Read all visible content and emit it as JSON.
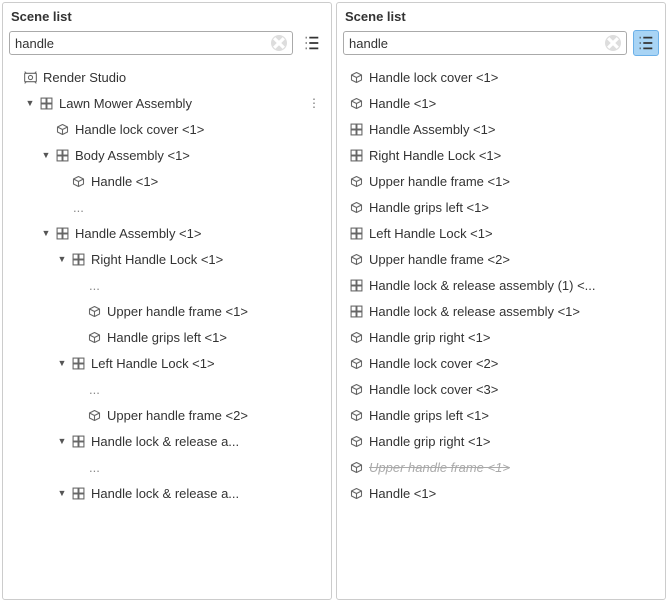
{
  "leftPanel": {
    "title": "Scene list",
    "searchValue": "handle",
    "listToggleActive": false,
    "rows": [
      {
        "depth": 0,
        "expander": "",
        "icon": "studio",
        "label": "Render Studio",
        "dots": false
      },
      {
        "depth": 1,
        "expander": "▼",
        "icon": "assembly",
        "label": "Lawn Mower Assembly",
        "dots": true
      },
      {
        "depth": 2,
        "expander": "",
        "icon": "part",
        "label": "Handle lock cover <1>"
      },
      {
        "depth": 2,
        "expander": "▼",
        "icon": "assembly",
        "label": "Body Assembly <1>"
      },
      {
        "depth": 3,
        "expander": "",
        "icon": "part",
        "label": "Handle <1>"
      },
      {
        "depth": 3,
        "expander": "",
        "icon": "none",
        "label": "...",
        "ellipsis": true
      },
      {
        "depth": 2,
        "expander": "▼",
        "icon": "assembly",
        "label": "Handle Assembly <1>"
      },
      {
        "depth": 3,
        "expander": "▼",
        "icon": "assembly",
        "label": "Right Handle Lock <1>"
      },
      {
        "depth": 4,
        "expander": "",
        "icon": "none",
        "label": "...",
        "ellipsis": true
      },
      {
        "depth": 4,
        "expander": "",
        "icon": "part",
        "label": "Upper handle frame <1>"
      },
      {
        "depth": 4,
        "expander": "",
        "icon": "part",
        "label": "Handle grips left <1>"
      },
      {
        "depth": 3,
        "expander": "▼",
        "icon": "assembly",
        "label": "Left Handle Lock <1>"
      },
      {
        "depth": 4,
        "expander": "",
        "icon": "none",
        "label": "...",
        "ellipsis": true
      },
      {
        "depth": 4,
        "expander": "",
        "icon": "part",
        "label": "Upper handle frame <2>"
      },
      {
        "depth": 3,
        "expander": "▼",
        "icon": "assembly",
        "label": "Handle lock & release a..."
      },
      {
        "depth": 4,
        "expander": "",
        "icon": "none",
        "label": "...",
        "ellipsis": true
      },
      {
        "depth": 3,
        "expander": "▼",
        "icon": "assembly",
        "label": "Handle lock & release a..."
      }
    ]
  },
  "rightPanel": {
    "title": "Scene list",
    "searchValue": "handle",
    "listToggleActive": true,
    "rows": [
      {
        "icon": "part",
        "label": "Handle lock cover <1>"
      },
      {
        "icon": "part",
        "label": "Handle <1>"
      },
      {
        "icon": "assembly",
        "label": "Handle Assembly <1>"
      },
      {
        "icon": "assembly",
        "label": "Right Handle Lock <1>"
      },
      {
        "icon": "part",
        "label": "Upper handle frame <1>"
      },
      {
        "icon": "part",
        "label": "Handle grips left <1>"
      },
      {
        "icon": "assembly",
        "label": "Left Handle Lock <1>"
      },
      {
        "icon": "part",
        "label": "Upper handle frame <2>"
      },
      {
        "icon": "assembly",
        "label": "Handle lock & release assembly (1) <..."
      },
      {
        "icon": "assembly",
        "label": "Handle lock & release assembly <1>"
      },
      {
        "icon": "part",
        "label": "Handle grip right <1>"
      },
      {
        "icon": "part",
        "label": "Handle lock cover <2>"
      },
      {
        "icon": "part",
        "label": "Handle lock cover <3>"
      },
      {
        "icon": "part",
        "label": "Handle grips left <1>"
      },
      {
        "icon": "part",
        "label": "Handle grip right <1>"
      },
      {
        "icon": "part",
        "label": "Upper handle frame <1>",
        "ghost": true,
        "strike": true
      },
      {
        "icon": "part",
        "label": "Handle <1>"
      }
    ]
  }
}
